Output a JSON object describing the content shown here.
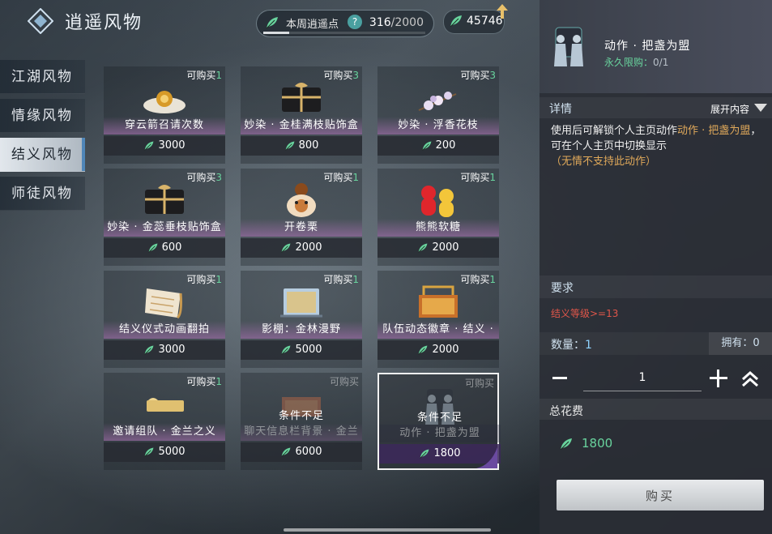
{
  "header": {
    "title": "逍遥风物",
    "points_label": "本周逍遥点",
    "help_icon": "?",
    "points_current": "316",
    "points_max": "/2000",
    "points_progress": 0.158,
    "currency_amount": "45746"
  },
  "tabs": [
    "江湖风物",
    "情缘风物",
    "结义风物",
    "师徒风物"
  ],
  "active_tab": 2,
  "grid": [
    {
      "name": "穿云箭召请次数",
      "price": "3000",
      "tag_prefix": "可购买",
      "tag_count": "1"
    },
    {
      "name": "妙染 · 金桂满枝贴饰盒",
      "price": "800",
      "tag_prefix": "可购买",
      "tag_count": "3"
    },
    {
      "name": "妙染 · 浮香花枝",
      "price": "200",
      "tag_prefix": "可购买",
      "tag_count": "3"
    },
    {
      "name": "妙染 · 金蕊垂枝贴饰盒",
      "price": "600",
      "tag_prefix": "可购买",
      "tag_count": "3"
    },
    {
      "name": "开卷栗",
      "price": "2000",
      "tag_prefix": "可购买",
      "tag_count": "1"
    },
    {
      "name": "熊熊软糖",
      "price": "2000",
      "tag_prefix": "可购买",
      "tag_count": "1"
    },
    {
      "name": "结义仪式动画翻拍",
      "price": "3000",
      "tag_prefix": "可购买",
      "tag_count": "1"
    },
    {
      "name": "影棚：金林漫野",
      "price": "5000",
      "tag_prefix": "可购买",
      "tag_count": "1"
    },
    {
      "name": "队伍动态徽章 · 结义 ·",
      "price": "2000",
      "tag_prefix": "可购买",
      "tag_count": "1"
    },
    {
      "name": "邀请组队 · 金兰之义",
      "price": "5000",
      "tag_prefix": "可购买",
      "tag_count": "1"
    },
    {
      "name": "聊天信息栏背景 · 金兰",
      "price": "6000",
      "tag_prefix": "可购买",
      "tag_count": "",
      "blocked": "条件不足"
    },
    {
      "name": "动作 · 把盏为盟",
      "price": "1800",
      "tag_prefix": "可购买",
      "tag_count": "",
      "blocked": "条件不足"
    }
  ],
  "panel": {
    "item_title": "动作 · 把盏为盟",
    "limit_label": "永久限购：",
    "limit_count": "0/1",
    "detail_heading": "详情",
    "expand_label": "展开内容",
    "desc_prefix": "使用后可解锁个人主页动作",
    "desc_highlight": "动作 · 把盏为盟",
    "desc_suffix": "，可在个人主页中切换显示",
    "desc_note": "（无情不支持此动作）",
    "req_heading": "要求",
    "req_text": "结义等级>=13",
    "qty_label": "数量：",
    "qty_value": "1",
    "owned": "拥有：0",
    "stepper_value": "1",
    "total_heading": "总花费",
    "total_value": "1800",
    "buy_label": "购买"
  },
  "colors": {
    "accent_green": "#69d49e",
    "warning_red": "#e0564a",
    "highlight_gold": "#e0a95a",
    "name_band_purple": "#a06eaa"
  }
}
